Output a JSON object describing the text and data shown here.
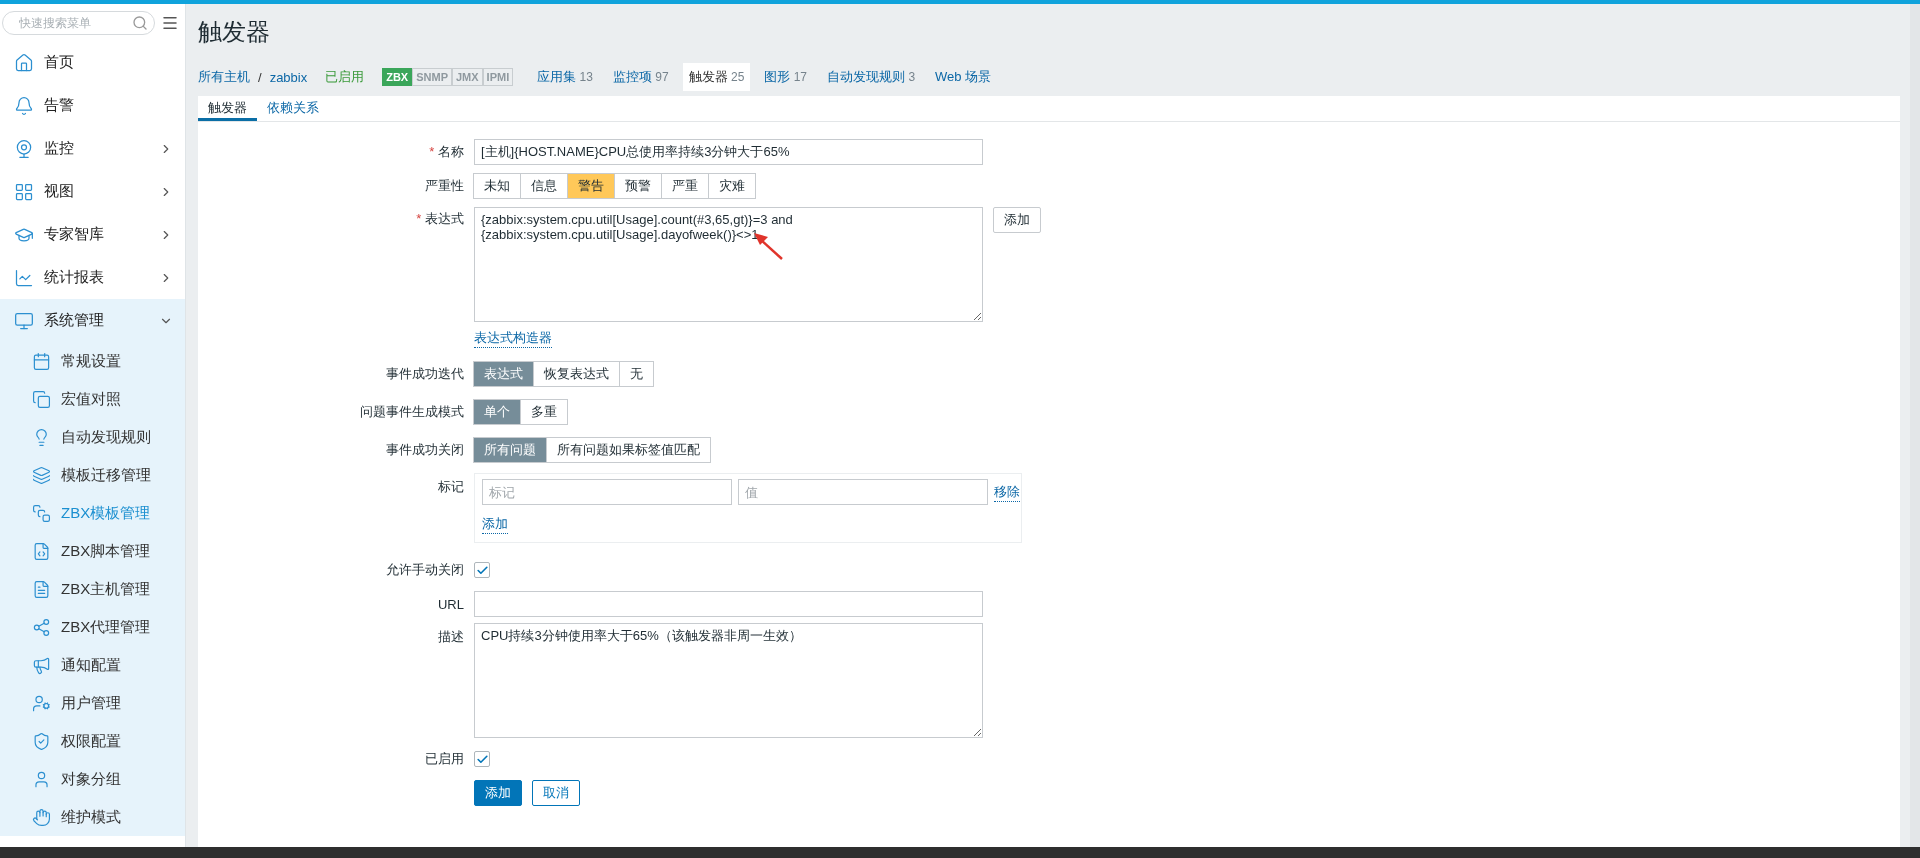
{
  "sidebar": {
    "search": {
      "placeholder": "快速搜索菜单"
    },
    "items": [
      {
        "label": "首页"
      },
      {
        "label": "告警"
      },
      {
        "label": "监控",
        "expandable": true,
        "expanded": false
      },
      {
        "label": "视图",
        "expandable": true,
        "expanded": false
      },
      {
        "label": "专家智库",
        "expandable": true,
        "expanded": false
      },
      {
        "label": "统计报表",
        "expandable": true,
        "expanded": false
      },
      {
        "label": "系统管理",
        "expandable": true,
        "expanded": true,
        "children": [
          {
            "label": "常规设置",
            "selected": false
          },
          {
            "label": "宏值对照",
            "selected": false
          },
          {
            "label": "自动发现规则",
            "selected": false
          },
          {
            "label": "模板迁移管理",
            "selected": false
          },
          {
            "label": "ZBX模板管理",
            "selected": true
          },
          {
            "label": "ZBX脚本管理",
            "selected": false
          },
          {
            "label": "ZBX主机管理",
            "selected": false
          },
          {
            "label": "ZBX代理管理",
            "selected": false
          },
          {
            "label": "通知配置",
            "selected": false
          },
          {
            "label": "用户管理",
            "selected": false
          },
          {
            "label": "权限配置",
            "selected": false
          },
          {
            "label": "对象分组",
            "selected": false
          },
          {
            "label": "维护模式",
            "selected": false
          }
        ]
      }
    ]
  },
  "page_title": "触发器",
  "host_nav": {
    "breadcrumbs": [
      "所有主机",
      "zabbix"
    ],
    "breadcrumb_separator": "/",
    "status": "已启用",
    "interfaces": [
      {
        "label": "ZBX",
        "on": true
      },
      {
        "label": "SNMP",
        "on": false
      },
      {
        "label": "JMX",
        "on": false
      },
      {
        "label": "IPMI",
        "on": false
      }
    ],
    "tabs": [
      {
        "label": "应用集",
        "count": "13",
        "selected": false
      },
      {
        "label": "监控项",
        "count": "97",
        "selected": false
      },
      {
        "label": "触发器",
        "count": "25",
        "selected": true
      },
      {
        "label": "图形",
        "count": "17",
        "selected": false
      },
      {
        "label": "自动发现规则",
        "count": "3",
        "selected": false
      },
      {
        "label": "Web 场景",
        "selected": false
      }
    ]
  },
  "form_tabs": [
    {
      "label": "触发器",
      "selected": true
    },
    {
      "label": "依赖关系",
      "selected": false
    }
  ],
  "form": {
    "name": {
      "label": "名称",
      "required_mark": "*",
      "value": "[主机]{HOST.NAME}CPU总使用率持续3分钟大于65%"
    },
    "severity": {
      "label": "严重性",
      "options": [
        {
          "label": "未知",
          "selected": false
        },
        {
          "label": "信息",
          "selected": false
        },
        {
          "label": "警告",
          "selected": true
        },
        {
          "label": "预警",
          "selected": false
        },
        {
          "label": "严重",
          "selected": false
        },
        {
          "label": "灾难",
          "selected": false
        }
      ]
    },
    "expression": {
      "label": "表达式",
      "required_mark": "*",
      "value": "{zabbix:system.cpu.util[Usage].count(#3,65,gt)}=3 and\n{zabbix:system.cpu.util[Usage].dayofweek()}<>1",
      "add_button": "添加",
      "constructor_link": "表达式构造器"
    },
    "ok_event_generation": {
      "label": "事件成功迭代",
      "options": [
        {
          "label": "表达式",
          "selected": true
        },
        {
          "label": "恢复表达式",
          "selected": false
        },
        {
          "label": "无",
          "selected": false
        }
      ]
    },
    "problem_generation_mode": {
      "label": "问题事件生成模式",
      "options": [
        {
          "label": "单个",
          "selected": true
        },
        {
          "label": "多重",
          "selected": false
        }
      ]
    },
    "ok_event_closes": {
      "label": "事件成功关闭",
      "options": [
        {
          "label": "所有问题",
          "selected": true
        },
        {
          "label": "所有问题如果标签值匹配",
          "selected": false
        }
      ]
    },
    "tags": {
      "label": "标记",
      "rows": [
        {
          "tag_placeholder": "标记",
          "value_placeholder": "值",
          "remove": "移除"
        }
      ],
      "add": "添加"
    },
    "allow_manual_close": {
      "label": "允许手动关闭",
      "checked": true
    },
    "url": {
      "label": "URL"
    },
    "description": {
      "label": "描述",
      "value": "CPU持续3分钟使用率大于65%（该触发器非周一生效）"
    },
    "enabled": {
      "label": "已启用",
      "checked": true
    },
    "buttons": [
      {
        "label": "添加",
        "kind": "primary"
      },
      {
        "label": "取消",
        "kind": "secondary"
      }
    ]
  }
}
